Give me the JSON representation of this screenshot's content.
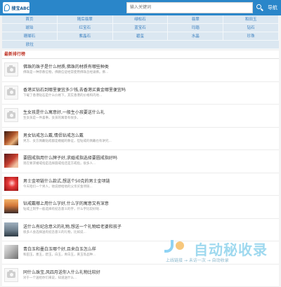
{
  "header": {
    "logo_text": "搜宝ABC",
    "search_placeholder": "输入关键词",
    "nav_label": "导航"
  },
  "menu": {
    "rows": [
      [
        "首页",
        "随后翡翠",
        "绿松石",
        "翡翠",
        "和田玉"
      ],
      [
        "琥珀",
        "红宝石",
        "蓝宝石",
        "玛瑙",
        "钻石"
      ],
      [
        "珊瑚石",
        "紫晶石",
        "碧玺",
        "水晶",
        "珍珠"
      ],
      [
        "欧拉",
        "",
        "",
        "",
        ""
      ]
    ]
  },
  "section": {
    "title": "最新排行榜"
  },
  "items": [
    {
      "title": "佛珠的珠子是什么材质,佛珠的材质有哪些种类",
      "desc": "佛珠是一种宗教信物，佛教信徒经常使用佛珠念经诵佛。佛...",
      "thumb": "placeholder"
    },
    {
      "title": "香港买钻石到哪里便宜多少钱,去香港买黄金哪里便宜吗",
      "desc": "下载了香港钻石是什么价格下，其实香港的价格和内地...",
      "thumb": "placeholder"
    },
    {
      "title": "生女孩是什么寓意好,一般生小孩要送什么礼",
      "desc": "生女孩是一件喜事，女孩的寓意有很多，...",
      "thumb": "placeholder"
    },
    {
      "title": "男女钻戒怎么戴,情侣钻戒怎么戴",
      "desc": "男方、女方佩戴钻戒都是婚姻的象征，但钻戒的佩戴也有讲究...",
      "thumb": "photo-1"
    },
    {
      "title": "要圆戒指用什么牌子好,求婚戒指选择要圆戒指好吗",
      "desc": "现在要求婚戒指是选择圆戒指还是方戒指，很多人...",
      "thumb": "photo-2"
    },
    {
      "title": "男士金项链什么款式,想送个50克的男士金项链",
      "desc": "今天咱们一个男人，他说想给他的父亲买金项链...",
      "thumb": "photo-3"
    },
    {
      "title": "钻戒戴哪上用什么字好,什么字的寓意又有深意",
      "desc": "钻戒上刻字一般选择有纪念意义的字，什么字比较好呢...",
      "thumb": "photo-4"
    },
    {
      "title": "送什么有纪念意义的礼物,想送一个礼物给老婆和孩子",
      "desc": "很多人会选择送有纪念意义的礼物，比如说...",
      "thumb": "photo-5"
    },
    {
      "title": "青白玉和墨白玉哪个好,且来白玉怎么样",
      "desc": "和田玉，墨玉，碧玉，白玉，青白玉，黄玉等品种...",
      "thumb": "photo-6"
    },
    {
      "title": "同什么珠宝,风四月送你入什么礼物比较好",
      "desc": "对于一个送给你们来说，知道送什么...",
      "thumb": "placeholder"
    }
  ],
  "watermark": {
    "brand": "自动秘收录",
    "tagline": "上线链接 → 未访一次 → 自动收录"
  },
  "colors": {
    "topbar": "#2a86c9",
    "menu_bg": "#dbe7f1",
    "menu_text": "#3a7fbf",
    "section_title": "#c0392b"
  }
}
